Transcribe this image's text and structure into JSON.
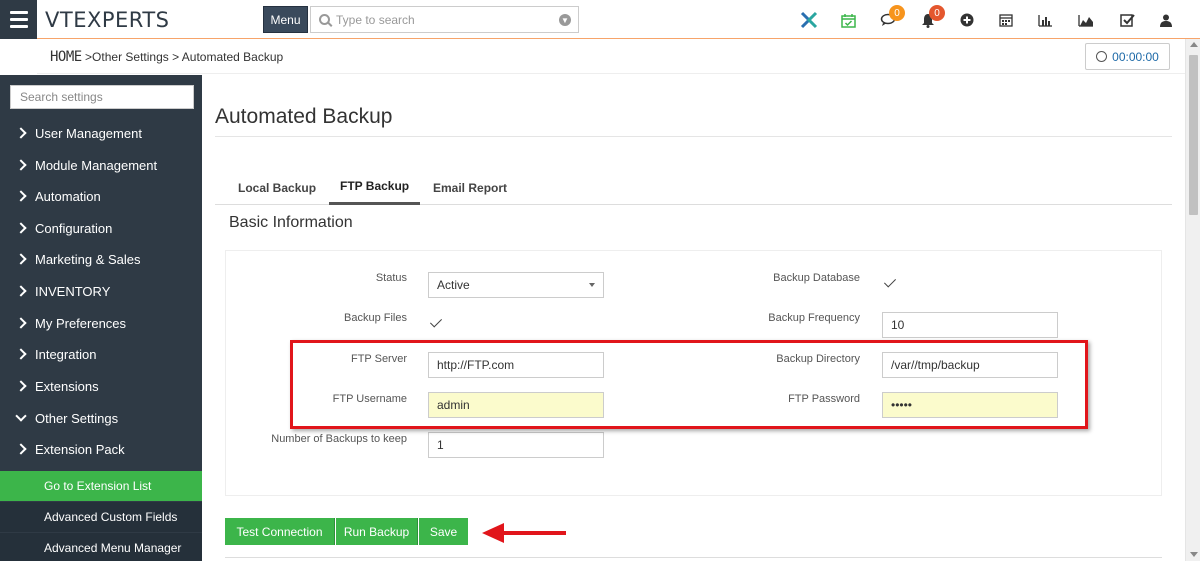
{
  "header": {
    "logo": "VTEXPERTS",
    "menu_label": "Menu",
    "search_placeholder": "Type to search",
    "chat_badge": "0",
    "notif_badge": "0",
    "badge_color": "#f7941d",
    "notif_badge_color": "#e4572e"
  },
  "breadcrumb": {
    "home": "HOME",
    "path": " >Other Settings > Automated Backup"
  },
  "timer": "00:00:00",
  "sidebar": {
    "search_placeholder": "Search settings",
    "items": [
      {
        "label": "User Management"
      },
      {
        "label": "Module Management"
      },
      {
        "label": "Automation"
      },
      {
        "label": "Configuration"
      },
      {
        "label": "Marketing & Sales"
      },
      {
        "label": "INVENTORY"
      },
      {
        "label": "My Preferences"
      },
      {
        "label": "Integration"
      },
      {
        "label": "Extensions"
      },
      {
        "label": "Other Settings"
      },
      {
        "label": "Extension Pack"
      }
    ],
    "subitems": [
      {
        "label": "Go to Extension List"
      },
      {
        "label": "Advanced Custom Fields"
      },
      {
        "label": "Advanced Menu Manager"
      }
    ]
  },
  "page": {
    "title": "Automated Backup",
    "tabs": [
      {
        "label": "Local Backup"
      },
      {
        "label": "FTP Backup"
      },
      {
        "label": "Email Report"
      }
    ],
    "section_title": "Basic Information"
  },
  "form": {
    "status_label": "Status",
    "status_value": "Active",
    "backup_database_label": "Backup Database",
    "backup_files_label": "Backup Files",
    "backup_frequency_label": "Backup Frequency",
    "backup_frequency_value": "10",
    "ftp_server_label": "FTP Server",
    "ftp_server_value": "http://FTP.com",
    "backup_directory_label": "Backup Directory",
    "backup_directory_value": "/var//tmp/backup",
    "ftp_username_label": "FTP Username",
    "ftp_username_value": "admin",
    "ftp_password_label": "FTP Password",
    "ftp_password_value": "•••••",
    "num_backups_label": "Number of Backups to keep",
    "num_backups_value": "1"
  },
  "buttons": {
    "test_connection": "Test Connection",
    "run_backup": "Run Backup",
    "save": "Save"
  },
  "colors": {
    "sidebar_bg": "#2f3a45",
    "accent_green": "#3cb54a",
    "highlight_red": "#e1151b"
  }
}
